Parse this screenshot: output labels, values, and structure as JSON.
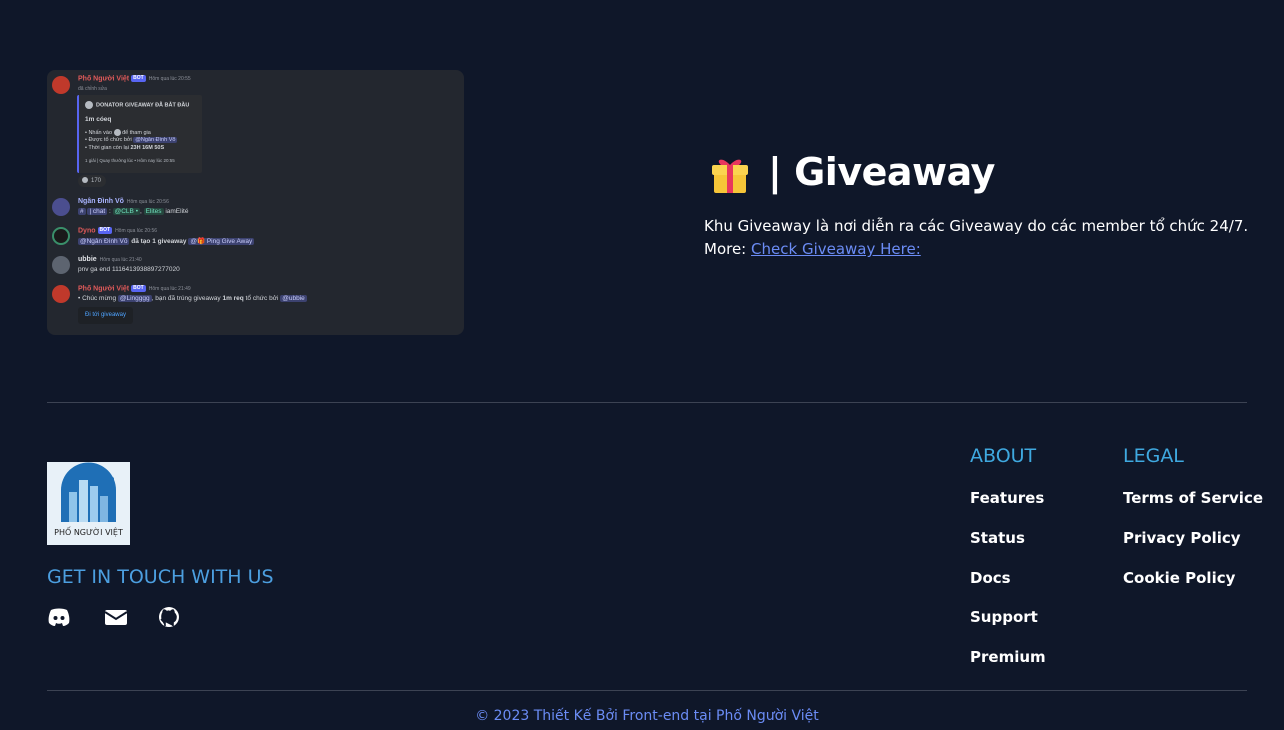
{
  "discord_preview": {
    "messages": [
      {
        "user": "Phố Người Việt",
        "tag": "BOT",
        "time": "Hôm qua lúc 20:55",
        "sub": "đã chỉnh sửa"
      },
      {
        "user": "Ngân Đình Võ",
        "time": "Hôm qua lúc 20:56",
        "text_a": "#",
        "chat": "| chat",
        "mention1": "@CLB •",
        "mention2": "Elites",
        "text_b": "iamElité"
      },
      {
        "user": "Dyno",
        "tag": "BOT",
        "time": "Hôm qua lúc 20:56",
        "mention1": "@Ngân Đình Võ",
        "text_a": "đã tạo 1 giveaway",
        "mention2": "@🎁 Ping Give Away"
      },
      {
        "user": "ubbie",
        "time": "Hôm qua lúc 21:40",
        "text_a": "pnv ga end 1116413938897277020"
      },
      {
        "user": "Phố Người Việt",
        "tag": "BOT",
        "time": "Hôm qua lúc 21:49",
        "text_a": "• Chúc mừng",
        "mention1": "@Lingggg",
        "text_b": ", bạn đã trúng giveaway",
        "bold": "1m req",
        "text_c": "tổ chức bởi",
        "mention2": "@ubbie"
      }
    ],
    "embed": {
      "title": "DONATOR GIVEAWAY ĐÃ BẮT ĐẦU",
      "prize": "1m cóeq",
      "line1": "• Nhấn vào",
      "line1b": "để tham gia",
      "line2": "• Được tổ chức bởi",
      "line2_mention": "@Ngân Đình Võ",
      "line3": "• Thời gian còn lại",
      "line3_value": "23H 16M 50S",
      "footer": "1 giải | Quay thưởng lúc • Hôm nay lúc 20:55"
    },
    "reaction_count": "170",
    "button_label": "Đi tới giveaway"
  },
  "feature": {
    "title": "| Giveaway",
    "description": "Khu Giveaway là nơi diễn ra các Giveaway do các member tổ chức 24/7.",
    "more_label": "More:",
    "link_text": "Check Giveaway Here:"
  },
  "footer": {
    "logo_text": "PHỐ NGƯỜI VIỆT",
    "contact_title": "GET IN TOUCH WITH US",
    "social_icons": [
      "discord-icon",
      "mail-icon",
      "github-icon"
    ],
    "about": {
      "title": "ABOUT",
      "items": [
        "Features",
        "Status",
        "Docs",
        "Support",
        "Premium"
      ]
    },
    "legal": {
      "title": "LEGAL",
      "items": [
        "Terms of Service",
        "Privacy Policy",
        "Cookie Policy"
      ]
    },
    "copyright": "© 2023 Thiết Kế Bởi Front-end tại Phố Người Việt"
  },
  "colors": {
    "background": "#0f1729",
    "accent_heading": "#3fa9e0",
    "link": "#6b8cf5"
  }
}
